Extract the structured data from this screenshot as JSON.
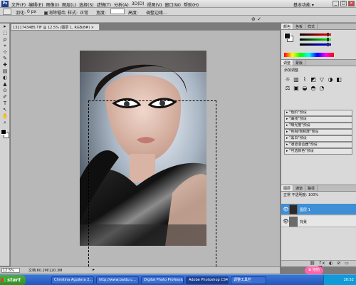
{
  "menubar": {
    "logo": "Ps",
    "menus": [
      "文件(F)",
      "编辑(E)",
      "图像(I)",
      "图层(L)",
      "选择(S)",
      "滤镜(T)",
      "分析(A)",
      "3D(D)",
      "视图(V)",
      "窗口(W)",
      "帮助(H)"
    ],
    "basic_func": "基本功能 ▾",
    "win_min": "_",
    "win_max": "□",
    "win_close": "×"
  },
  "options": {
    "feather_label": "羽化:",
    "feather_value": "0 px",
    "antialias_label": "消除锯齿",
    "style_label": "样式:",
    "style_value": "正常",
    "width_label": "宽度:",
    "height_label": "高度:",
    "refine_button": "调整边缘..."
  },
  "bar2": {
    "commit_icons": "⊘  ✓"
  },
  "toolbox": {
    "tools": [
      "▸",
      "⬚",
      "ρ",
      "⌖",
      "⊹",
      "✎",
      "✚",
      "▤",
      "◐",
      "▲",
      "⊙",
      "✐",
      "T",
      "↖",
      "✋",
      "⌕"
    ]
  },
  "document": {
    "tab_title": "1321743485.TIF @ 12.5% (图层 1, RGB/8#) ×",
    "zoom": "12.5%",
    "info": "文档:60.2M/120.3M",
    "status_arrow": "▸"
  },
  "panels": {
    "color_tabs": [
      "颜色",
      "色板",
      "样式"
    ],
    "adj_tabs": [
      "调整",
      "蒙版"
    ],
    "adj_title": "添加调整",
    "adj_icons": [
      "☼",
      "▥",
      "⌇",
      "◩",
      "▽",
      "◑",
      "◧",
      "⚖",
      "▣",
      "◒",
      "◓",
      "◔"
    ],
    "presets": [
      "▸ \"色阶\"预设",
      "▸ \"曲线\"预设",
      "▸ \"曝光度\"预设",
      "▸ \"色相/饱和度\"预设",
      "▸ \"黑白\"预设",
      "▸ \"通道混合器\"预设",
      "▸ \"可选颜色\"预设"
    ],
    "layers_tabs": [
      "图层",
      "通道",
      "路径"
    ],
    "layer_opts": "正常  不透明度: 100%",
    "layers": [
      {
        "name": "图层 1",
        "selected": true
      },
      {
        "name": "背景",
        "selected": false
      }
    ],
    "layer_footer": "⛓ fx ◐ ⊘ ▭ ⊕ 🗑"
  },
  "taskbar": {
    "start": "start",
    "tasks": [
      "Christina Aguilera 2...",
      "http://www.baidu.c...",
      "Digital Photo Professio...",
      "Adobe Photoshop CS4...",
      "调整工具栏"
    ],
    "active_task_index": 3,
    "clock": "20:52",
    "badge": "✿ 拍拍"
  },
  "colors": {
    "selected_layer": "#3f8fd6",
    "taskbar": "#2456b8",
    "start": "#2f8a27"
  }
}
